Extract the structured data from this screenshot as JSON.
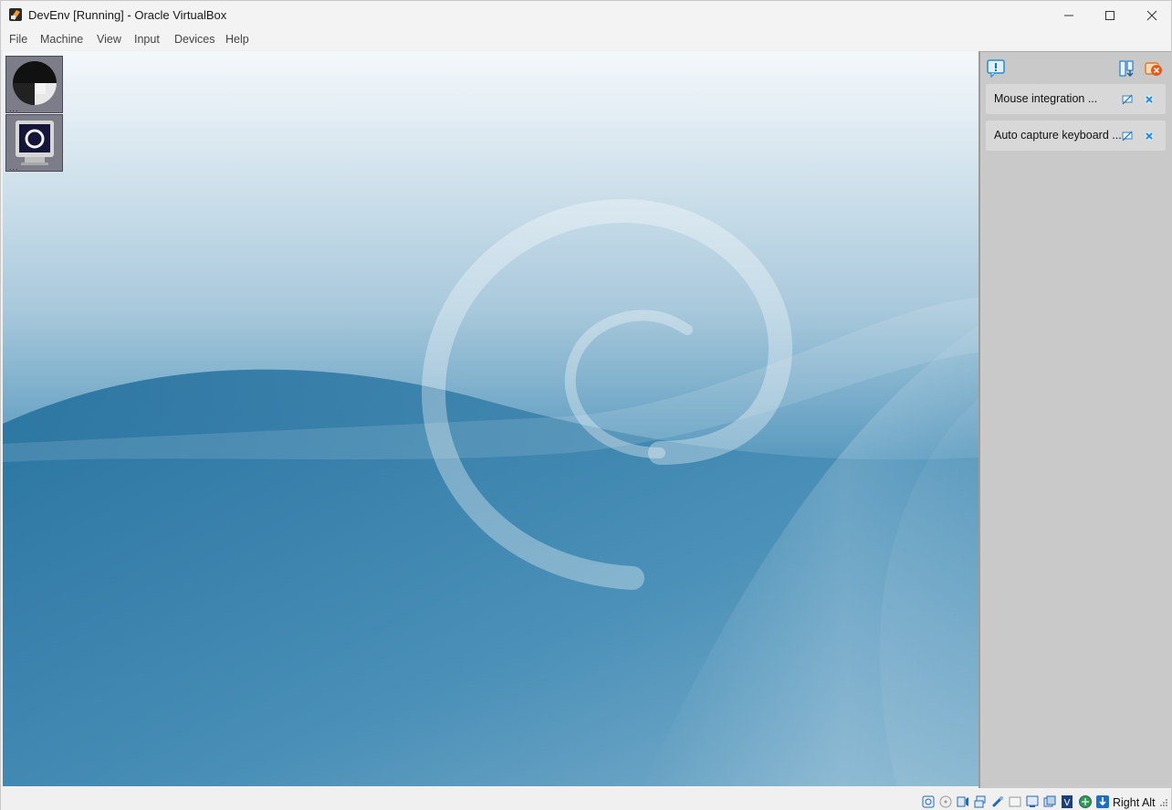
{
  "window": {
    "title": "DevEnv [Running] - Oracle VirtualBox",
    "minimize_icon": "minimize-icon",
    "maximize_icon": "maximize-icon",
    "close_icon": "close-icon"
  },
  "menu": {
    "items": [
      "File",
      "Machine",
      "View",
      "Input",
      "Devices",
      "Help"
    ]
  },
  "desktop": {
    "icons": [
      {
        "name": "desktop-icon-1",
        "dots": "..."
      },
      {
        "name": "desktop-icon-2",
        "dots": "..."
      }
    ]
  },
  "notifications": {
    "items": [
      {
        "text": "Mouse integration ..."
      },
      {
        "text": "Auto capture keyboard ..."
      }
    ]
  },
  "statusbar": {
    "host_key": "Right Alt"
  },
  "colors": {
    "accent": "#2e7aa6",
    "panel": "#c9c9c9"
  }
}
